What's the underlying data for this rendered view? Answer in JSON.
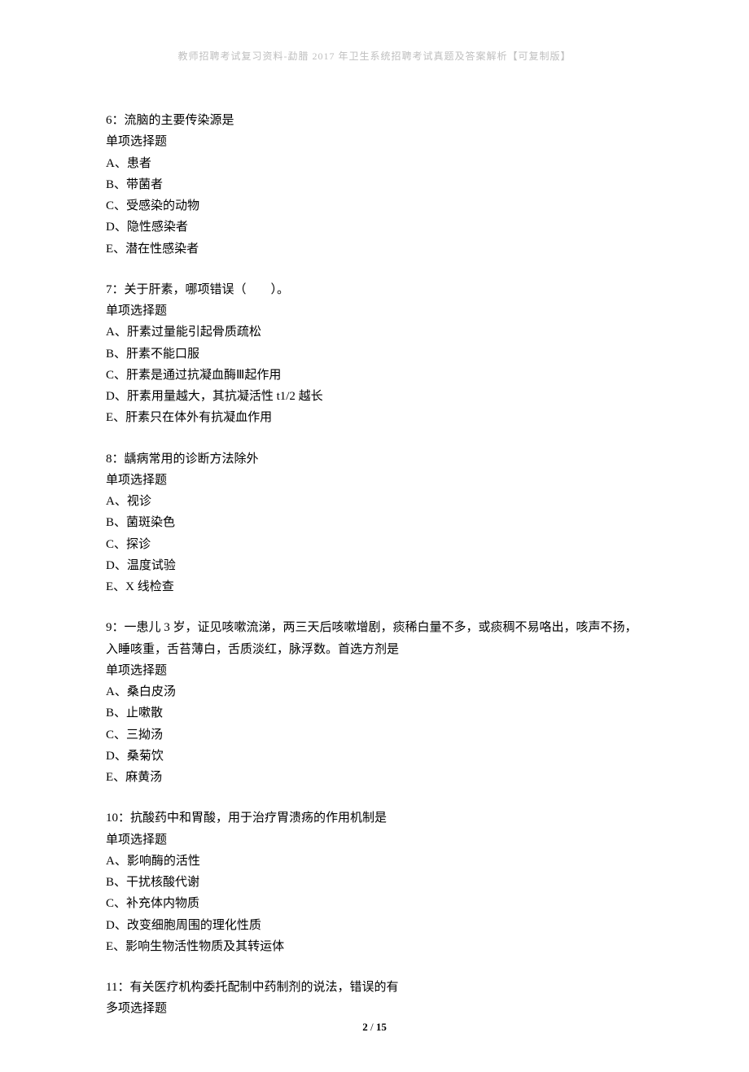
{
  "header": "教师招聘考试复习资料-勐腊 2017 年卫生系统招聘考试真题及答案解析【可复制版】",
  "questions": [
    {
      "stem": "6：流脑的主要传染源是",
      "type": "单项选择题",
      "options": [
        "A、患者",
        "B、带菌者",
        "C、受感染的动物",
        "D、隐性感染者",
        "E、潜在性感染者"
      ]
    },
    {
      "stem": "7：关于肝素，哪项错误（　　）。",
      "type": "单项选择题",
      "options": [
        "A、肝素过量能引起骨质疏松",
        "B、肝素不能口服",
        "C、肝素是通过抗凝血酶Ⅲ起作用",
        "D、肝素用量越大，其抗凝活性 t1/2 越长",
        "E、肝素只在体外有抗凝血作用"
      ]
    },
    {
      "stem": "8：龋病常用的诊断方法除外",
      "type": "单项选择题",
      "options": [
        "A、视诊",
        "B、菌斑染色",
        "C、探诊",
        "D、温度试验",
        "E、X 线检查"
      ]
    },
    {
      "stem": "9：一患儿 3 岁，证见咳嗽流涕，两三天后咳嗽增剧，痰稀白量不多，或痰稠不易咯出，咳声不扬，入睡咳重，舌苔薄白，舌质淡红，脉浮数。首选方剂是",
      "type": "单项选择题",
      "options": [
        "A、桑白皮汤",
        "B、止嗽散",
        "C、三拗汤",
        "D、桑菊饮",
        "E、麻黄汤"
      ]
    },
    {
      "stem": "10：抗酸药中和胃酸，用于治疗胃溃疡的作用机制是",
      "type": "单项选择题",
      "options": [
        "A、影响酶的活性",
        "B、干扰核酸代谢",
        "C、补充体内物质",
        "D、改变细胞周围的理化性质",
        "E、影响生物活性物质及其转运体"
      ]
    },
    {
      "stem": "11：有关医疗机构委托配制中药制剂的说法，错误的有",
      "type": "多项选择题",
      "options": []
    }
  ],
  "footer": {
    "page": "2",
    "sep": " / ",
    "total": "15"
  }
}
